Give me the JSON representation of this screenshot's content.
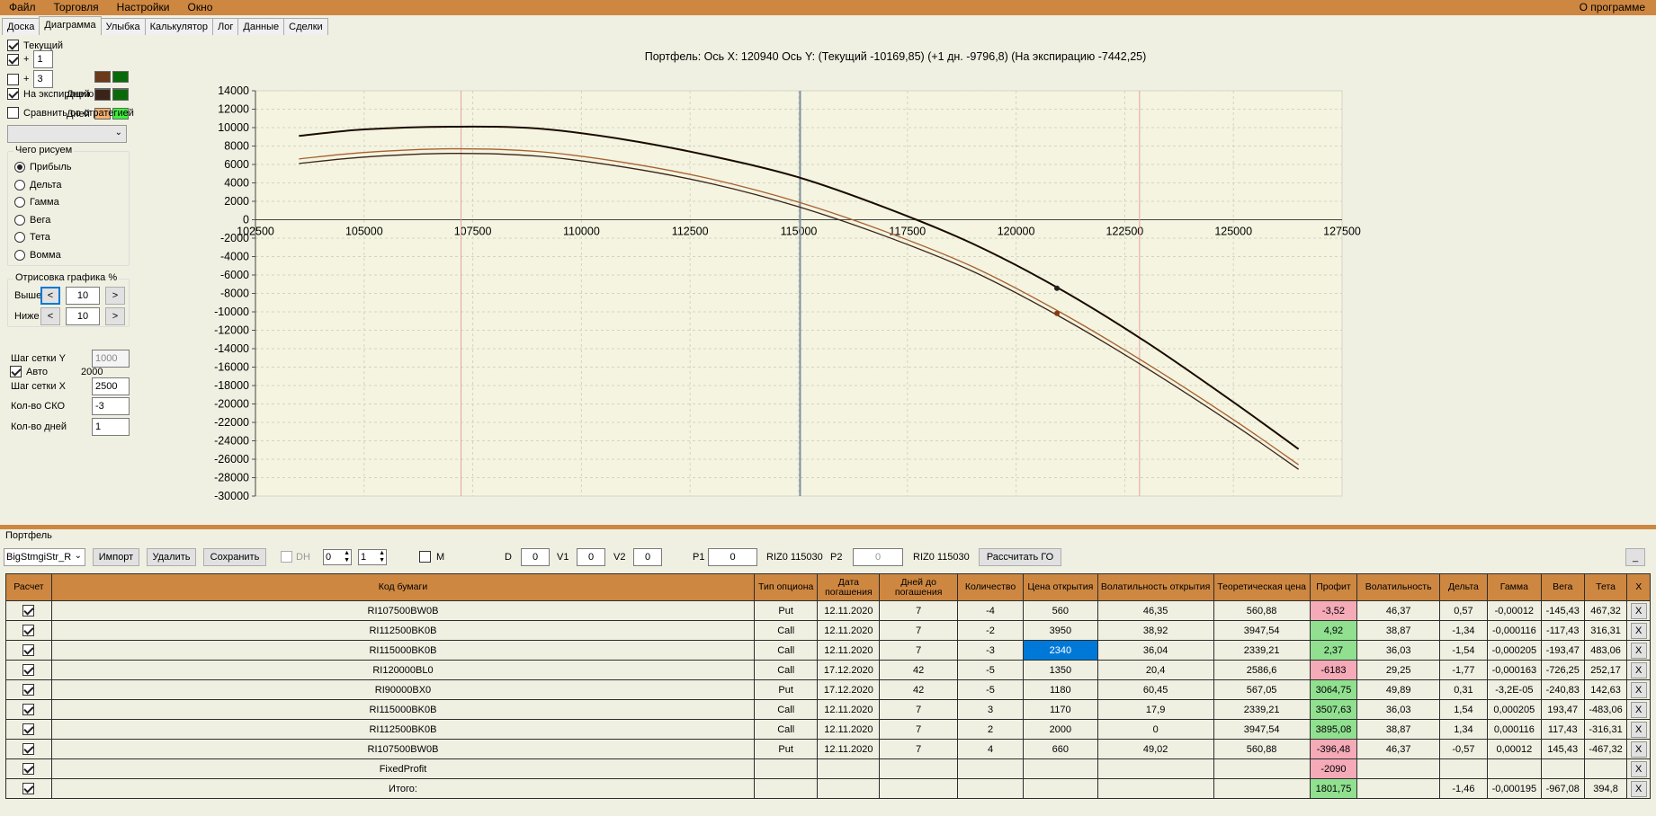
{
  "menu": {
    "items": [
      "Файл",
      "Торговля",
      "Настройки",
      "Окно"
    ],
    "about": "О программе"
  },
  "tabs": [
    "Доска",
    "Диаграмма",
    "Улыбка",
    "Калькулятор",
    "Лог",
    "Данные",
    "Сделки"
  ],
  "active_tab": "Диаграмма",
  "left": {
    "current_label": "Текущий",
    "plus1_label": "+",
    "plus1_value": "1",
    "days_label": "Дней",
    "plus3_label": "+",
    "plus3_value": "3",
    "expiry_label": "На экспирацию",
    "compare_label": "Сравнить со стратегией",
    "what_title": "Чего рисуем",
    "what_options": [
      "Прибыль",
      "Дельта",
      "Гамма",
      "Вега",
      "Тета",
      "Вомма"
    ],
    "draw_title": "Отрисовка графика %",
    "above_label": "Выше",
    "above_value": "10",
    "below_label": "Ниже",
    "below_value": "10",
    "prev_symbol": "<",
    "next_symbol": ">",
    "grid_y_label": "Шаг сетки Y",
    "grid_y_value": "1000",
    "auto_label": "Авто",
    "auto_value": "2000",
    "grid_x_label": "Шаг сетки X",
    "grid_x_value": "2500",
    "sko_label": "Кол-во СКО",
    "sko_value": "-3",
    "days_count_label": "Кол-во дней",
    "days_count_value": "1",
    "colors": {
      "current": [
        "#6b3a1a",
        "#0a6a0a"
      ],
      "plus1": [
        "#a86030",
        "#1fa81f"
      ],
      "plus3": [
        "#f2b070",
        "#3af23a"
      ],
      "expiry": [
        "#3a2418",
        "#0a6a0a"
      ]
    }
  },
  "chart_title": "Портфель: Ось X: 120940 Ось Y:  (Текущий -10169,85)  (+1 дн. -9796,8)  (На экспирацию -7442,25)",
  "chart_data": {
    "type": "line",
    "xlim": [
      102500,
      127500
    ],
    "ylim": [
      -30000,
      14000
    ],
    "x_ticks": [
      "102500",
      "105000",
      "107500",
      "110000",
      "112500",
      "115000",
      "117500",
      "120000",
      "122500",
      "125000",
      "127500"
    ],
    "y_ticks": [
      "14000",
      "12000",
      "10000",
      "8000",
      "6000",
      "4000",
      "2000",
      "0",
      "-2000",
      "-4000",
      "-6000",
      "-8000",
      "-10000",
      "-12000",
      "-14000",
      "-16000",
      "-18000",
      "-20000",
      "-22000",
      "-24000",
      "-26000",
      "-28000",
      "-30000"
    ],
    "grid": true,
    "vlines": [
      {
        "x": 107230,
        "color": "#e8a0a0"
      },
      {
        "x": 115030,
        "color": "#8090a0"
      },
      {
        "x": 122840,
        "color": "#e8a0a0"
      }
    ],
    "series": [
      {
        "color": "#1a0a00",
        "x": [
          103500,
          105000,
          107000,
          109000,
          111000,
          113000,
          115000,
          117000,
          119000,
          121000,
          123000,
          125000,
          126500
        ],
        "y": [
          9100,
          9800,
          10100,
          9900,
          8700,
          6900,
          4600,
          1300,
          -2600,
          -7500,
          -13300,
          -19800,
          -24900
        ]
      },
      {
        "color": "#a86030",
        "x": [
          103500,
          105000,
          107000,
          109000,
          111000,
          113000,
          115000,
          117000,
          119000,
          121000,
          123000,
          125000,
          126500
        ],
        "y": [
          6600,
          7300,
          7700,
          7400,
          6200,
          4400,
          1900,
          -1300,
          -5100,
          -10000,
          -15600,
          -21700,
          -26600
        ]
      },
      {
        "color": "#3a2418",
        "x": [
          103500,
          105000,
          107000,
          109000,
          111000,
          113000,
          115000,
          117000,
          119000,
          121000,
          123000,
          125000,
          126500
        ],
        "y": [
          6100,
          6800,
          7200,
          6900,
          5700,
          3900,
          1400,
          -1800,
          -5600,
          -10500,
          -16100,
          -22200,
          -27100
        ]
      }
    ],
    "markers": [
      {
        "x": 120940,
        "y": -7442,
        "color": "#222"
      },
      {
        "x": 120940,
        "y": -10170,
        "color": "#8a3a10"
      }
    ]
  },
  "portfolio_label": "Портфель",
  "toolbar": {
    "strategy": "BigStmgiStr_R",
    "import": "Импорт",
    "delete": "Удалить",
    "save": "Сохранить",
    "dh": "DH",
    "dh1": "0",
    "dh2": "1",
    "m": "M",
    "d_label": "D",
    "d_val": "0",
    "v1_label": "V1",
    "v1_val": "0",
    "v2_label": "V2",
    "v2_val": "0",
    "p1_label": "P1",
    "p1_val": "0",
    "riz1": "RIZ0 115030",
    "p2_label": "P2",
    "p2_val": "0",
    "riz2": "RIZ0 115030",
    "calc_go": "Рассчитать ГО",
    "minimize": "_"
  },
  "table": {
    "headers": [
      "Расчет",
      "Код бумаги",
      "Тип опциона",
      "Дата погашения",
      "Дней до погашения",
      "Количество",
      "Цена открытия",
      "Волатильность открытия",
      "Теоретическая цена",
      "Профит",
      "Волатильность",
      "Дельта",
      "Гамма",
      "Вега",
      "Тета",
      "X"
    ],
    "rows": [
      {
        "code": "RI107500BW0B",
        "type": "Put",
        "date": "12.11.2020",
        "days": "7",
        "qty": "-4",
        "price": "560",
        "vol_open": "46,35",
        "theo": "560,88",
        "profit": "-3,52",
        "profit_sign": "neg",
        "vol": "46,37",
        "delta": "0,57",
        "gamma": "-0,00012",
        "vega": "-145,43",
        "theta": "467,32"
      },
      {
        "code": "RI112500BK0B",
        "type": "Call",
        "date": "12.11.2020",
        "days": "7",
        "qty": "-2",
        "price": "3950",
        "vol_open": "38,92",
        "theo": "3947,54",
        "profit": "4,92",
        "profit_sign": "pos",
        "vol": "38,87",
        "delta": "-1,34",
        "gamma": "-0,000116",
        "vega": "-117,43",
        "theta": "316,31"
      },
      {
        "code": "RI115000BK0B",
        "type": "Call",
        "date": "12.11.2020",
        "days": "7",
        "qty": "-3",
        "price": "2340",
        "vol_open": "36,04",
        "theo": "2339,21",
        "profit": "2,37",
        "profit_sign": "pos",
        "vol": "36,03",
        "delta": "-1,54",
        "gamma": "-0,000205",
        "vega": "-193,47",
        "theta": "483,06"
      },
      {
        "code": "RI120000BL0",
        "type": "Call",
        "date": "17.12.2020",
        "days": "42",
        "qty": "-5",
        "price": "1350",
        "vol_open": "20,4",
        "theo": "2586,6",
        "profit": "-6183",
        "profit_sign": "neg",
        "vol": "29,25",
        "delta": "-1,77",
        "gamma": "-0,000163",
        "vega": "-726,25",
        "theta": "252,17"
      },
      {
        "code": "RI90000BX0",
        "type": "Put",
        "date": "17.12.2020",
        "days": "42",
        "qty": "-5",
        "price": "1180",
        "vol_open": "60,45",
        "theo": "567,05",
        "profit": "3064,75",
        "profit_sign": "pos",
        "vol": "49,89",
        "delta": "0,31",
        "gamma": "-3,2E-05",
        "vega": "-240,83",
        "theta": "142,63"
      },
      {
        "code": "RI115000BK0B",
        "type": "Call",
        "date": "12.11.2020",
        "days": "7",
        "qty": "3",
        "price": "1170",
        "vol_open": "17,9",
        "theo": "2339,21",
        "profit": "3507,63",
        "profit_sign": "pos",
        "vol": "36,03",
        "delta": "1,54",
        "gamma": "0,000205",
        "vega": "193,47",
        "theta": "-483,06"
      },
      {
        "code": "RI112500BK0B",
        "type": "Call",
        "date": "12.11.2020",
        "days": "7",
        "qty": "2",
        "price": "2000",
        "vol_open": "0",
        "theo": "3947,54",
        "profit": "3895,08",
        "profit_sign": "pos",
        "vol": "38,87",
        "delta": "1,34",
        "gamma": "0,000116",
        "vega": "117,43",
        "theta": "-316,31"
      },
      {
        "code": "RI107500BW0B",
        "type": "Put",
        "date": "12.11.2020",
        "days": "7",
        "qty": "4",
        "price": "660",
        "vol_open": "49,02",
        "theo": "560,88",
        "profit": "-396,48",
        "profit_sign": "neg",
        "vol": "46,37",
        "delta": "-0,57",
        "gamma": "0,00012",
        "vega": "145,43",
        "theta": "-467,32"
      },
      {
        "code": "FixedProfit",
        "type": "",
        "date": "",
        "days": "",
        "qty": "",
        "price": "",
        "vol_open": "",
        "theo": "",
        "profit": "-2090",
        "profit_sign": "neg",
        "vol": "",
        "delta": "",
        "gamma": "",
        "vega": "",
        "theta": ""
      },
      {
        "code": "Итого:",
        "type": "",
        "date": "",
        "days": "",
        "qty": "",
        "price": "",
        "vol_open": "",
        "theo": "",
        "profit": "1801,75",
        "profit_sign": "pos",
        "vol": "",
        "delta": "-1,46",
        "gamma": "-0,000195",
        "vega": "-967,08",
        "theta": "394,8"
      }
    ],
    "x_label": "X"
  }
}
